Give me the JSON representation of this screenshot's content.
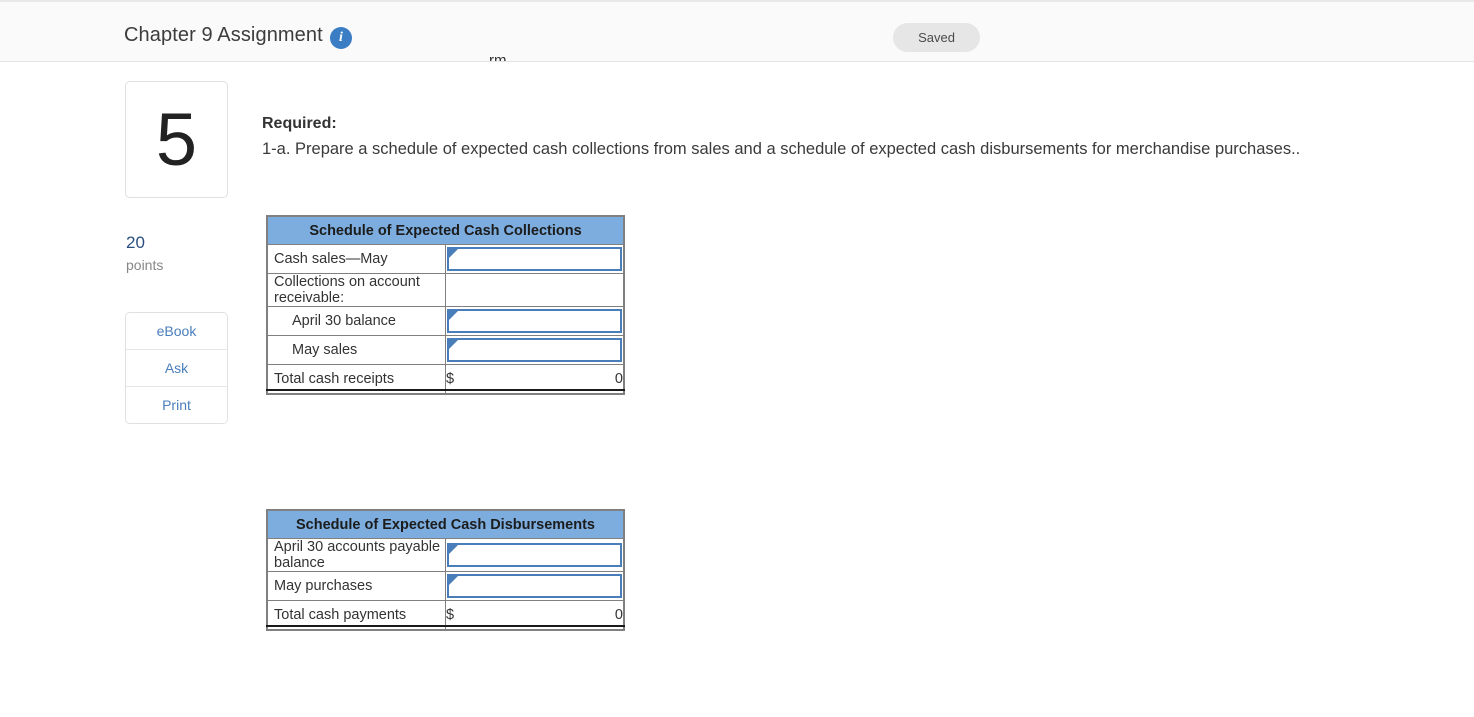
{
  "header": {
    "title": "Chapter 9 Assignment",
    "info_icon": "info-icon",
    "status_badge": "Saved",
    "clipped_remnant": "rm"
  },
  "sidebar": {
    "question_number": "5",
    "points_value": "20",
    "points_label": "points",
    "actions": [
      {
        "label": "eBook",
        "name": "ebook"
      },
      {
        "label": "Ask",
        "name": "ask"
      },
      {
        "label": "Print",
        "name": "print"
      }
    ]
  },
  "prompt": {
    "required_label": "Required:",
    "required_text": "1-a. Prepare a schedule of expected cash collections from sales and a schedule of expected cash disbursements for merchandise purchases.."
  },
  "tables": [
    {
      "title": "Schedule of Expected Cash Collections",
      "rows": [
        {
          "label": "Cash sales—May",
          "type": "input",
          "value": "",
          "indent": false
        },
        {
          "label": "Collections on account receivable:",
          "type": "blank",
          "value": "",
          "indent": false
        },
        {
          "label": "April 30 balance",
          "type": "input",
          "value": "",
          "indent": true
        },
        {
          "label": "May sales",
          "type": "input",
          "value": "",
          "indent": true
        },
        {
          "label": "Total cash receipts",
          "type": "total",
          "currency": "$",
          "value": "0",
          "indent": false
        }
      ]
    },
    {
      "title": "Schedule of Expected Cash Disbursements",
      "rows": [
        {
          "label": "April 30 accounts payable balance",
          "type": "input",
          "value": "",
          "indent": false
        },
        {
          "label": "May purchases",
          "type": "input",
          "value": "",
          "indent": false
        },
        {
          "label": "Total cash payments",
          "type": "total",
          "currency": "$",
          "value": "0",
          "indent": false
        }
      ]
    }
  ],
  "colors": {
    "table_header_blue": "#7cadde",
    "input_border_blue": "#4a7ebb",
    "link_blue": "#4a7ebb",
    "points_blue": "#2b4f7e",
    "badge_gray": "#e6e6e6"
  }
}
